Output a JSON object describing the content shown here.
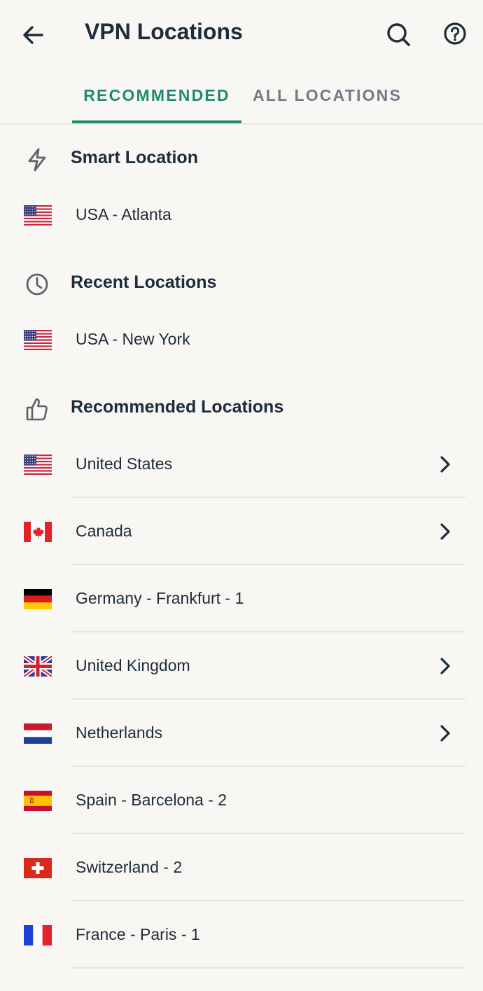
{
  "header": {
    "title": "VPN Locations",
    "back_icon": "arrow-left-icon",
    "search_icon": "search-icon",
    "help_icon": "help-circle-icon"
  },
  "tabs": [
    {
      "label": "RECOMMENDED",
      "selected": true
    },
    {
      "label": "ALL LOCATIONS",
      "selected": false
    }
  ],
  "colors": {
    "accent": "#1f8a6d",
    "text": "#1d2b3a",
    "inactive_tab": "#707b82",
    "background": "#f8f7f4"
  },
  "smart": {
    "title": "Smart Location",
    "icon": "lightning-icon",
    "location": {
      "label": "USA - Atlanta",
      "flag": "us"
    }
  },
  "recent": {
    "title": "Recent Locations",
    "icon": "clock-icon",
    "location": {
      "label": "USA - New York",
      "flag": "us"
    }
  },
  "recommended": {
    "title": "Recommended Locations",
    "icon": "thumbs-up-icon",
    "items": [
      {
        "label": "United States",
        "flag": "us",
        "has_submenu": true
      },
      {
        "label": "Canada",
        "flag": "ca",
        "has_submenu": true
      },
      {
        "label": "Germany - Frankfurt - 1",
        "flag": "de",
        "has_submenu": false
      },
      {
        "label": "United Kingdom",
        "flag": "gb",
        "has_submenu": true
      },
      {
        "label": "Netherlands",
        "flag": "nl",
        "has_submenu": true
      },
      {
        "label": "Spain - Barcelona - 2",
        "flag": "es",
        "has_submenu": false
      },
      {
        "label": "Switzerland - 2",
        "flag": "ch",
        "has_submenu": false
      },
      {
        "label": "France - Paris - 1",
        "flag": "fr",
        "has_submenu": false
      }
    ]
  }
}
